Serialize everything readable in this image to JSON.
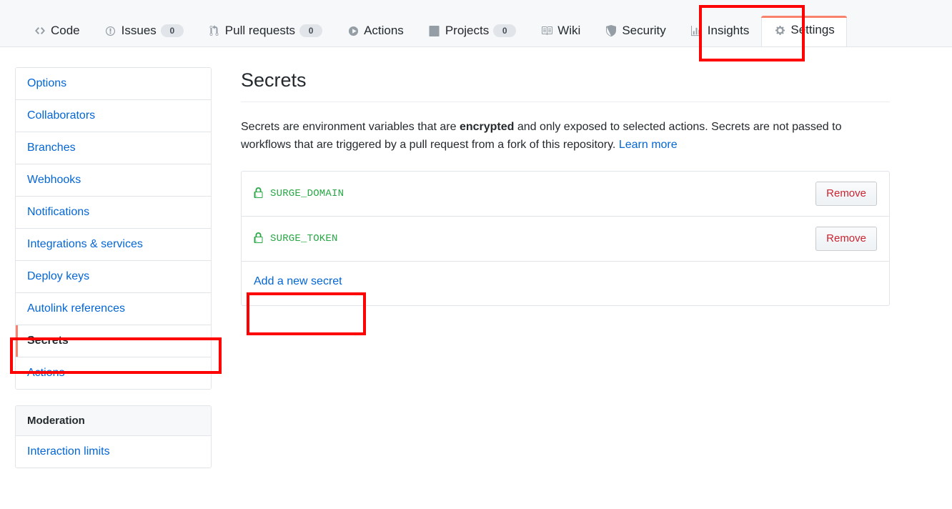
{
  "nav": {
    "items": [
      {
        "label": "Code",
        "icon": "code-icon",
        "count": null,
        "selected": false
      },
      {
        "label": "Issues",
        "icon": "issue-opened-icon",
        "count": "0",
        "selected": false
      },
      {
        "label": "Pull requests",
        "icon": "git-pull-request-icon",
        "count": "0",
        "selected": false
      },
      {
        "label": "Actions",
        "icon": "play-icon",
        "count": null,
        "selected": false
      },
      {
        "label": "Projects",
        "icon": "project-icon",
        "count": "0",
        "selected": false
      },
      {
        "label": "Wiki",
        "icon": "book-icon",
        "count": null,
        "selected": false
      },
      {
        "label": "Security",
        "icon": "shield-icon",
        "count": null,
        "selected": false
      },
      {
        "label": "Insights",
        "icon": "graph-icon",
        "count": null,
        "selected": false
      },
      {
        "label": "Settings",
        "icon": "gear-icon",
        "count": null,
        "selected": true
      }
    ]
  },
  "sidebar": {
    "main_items": [
      {
        "label": "Options",
        "selected": false
      },
      {
        "label": "Collaborators",
        "selected": false
      },
      {
        "label": "Branches",
        "selected": false
      },
      {
        "label": "Webhooks",
        "selected": false
      },
      {
        "label": "Notifications",
        "selected": false
      },
      {
        "label": "Integrations & services",
        "selected": false
      },
      {
        "label": "Deploy keys",
        "selected": false
      },
      {
        "label": "Autolink references",
        "selected": false
      },
      {
        "label": "Secrets",
        "selected": true
      },
      {
        "label": "Actions",
        "selected": false
      }
    ],
    "moderation": {
      "heading": "Moderation",
      "items": [
        {
          "label": "Interaction limits",
          "selected": false
        }
      ]
    }
  },
  "main": {
    "title": "Secrets",
    "description": {
      "part1": "Secrets are environment variables that are ",
      "bold": "encrypted",
      "part2": " and only exposed to selected actions. Secrets are not passed to workflows that are triggered by a pull request from a fork of this repository. ",
      "link": "Learn more"
    },
    "secrets": [
      {
        "name": "SURGE_DOMAIN",
        "icon": "lock-icon",
        "remove_label": "Remove"
      },
      {
        "name": "SURGE_TOKEN",
        "icon": "lock-icon",
        "remove_label": "Remove"
      }
    ],
    "add_secret_label": "Add a new secret"
  },
  "colors": {
    "accent_orange": "#f9826c",
    "link_blue": "#0366d6",
    "secret_green": "#28a745",
    "remove_red": "#cb2431",
    "annotation_red": "#ff0000",
    "nav_bg": "#f6f8fa",
    "border": "#e1e4e8"
  },
  "annotations": [
    {
      "target": "settings-tab",
      "color": "#ff0000"
    },
    {
      "target": "sidebar-secrets",
      "color": "#ff0000"
    },
    {
      "target": "add-new-secret",
      "color": "#ff0000"
    }
  ]
}
